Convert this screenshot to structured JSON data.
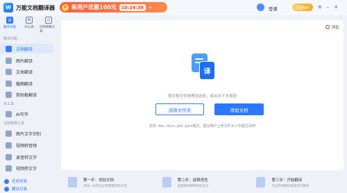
{
  "app": {
    "logo_char": "W",
    "name": "万能文档翻译器"
  },
  "promo": {
    "icon": "¥",
    "text": "新用户优惠100元",
    "countdown": "10:24:38",
    "arrow": "»"
  },
  "user": {
    "login_label": "登录",
    "vip_label": "开通VIP"
  },
  "window": {
    "menu": "≡",
    "minimize": "–",
    "close": "×"
  },
  "top_icons": [
    {
      "glyph": "译",
      "label": "翻译功能",
      "active": true
    },
    {
      "glyph": "AI",
      "label": "AI工具",
      "active": false
    },
    {
      "glyph": "⇄",
      "label": "识别转换工具",
      "active": false
    }
  ],
  "sidebar": {
    "section_translate": "翻译功能",
    "section_ai": "AI工具",
    "section_convert": "识别转换工具",
    "items": [
      {
        "label": "文档翻译",
        "active": true
      },
      {
        "label": "图片翻译"
      },
      {
        "label": "文本翻译"
      },
      {
        "label": "截图翻译"
      },
      {
        "label": "剪贴板翻译"
      },
      {
        "label": "AI写作"
      },
      {
        "label": "图片文字识别"
      },
      {
        "label": "视频转音频"
      },
      {
        "label": "录音转文字"
      },
      {
        "label": "视频转文字"
      }
    ],
    "bottom": [
      {
        "label": "任务列表"
      },
      {
        "label": "翻译记录"
      }
    ]
  },
  "main": {
    "compare_label": "对比",
    "doc_icon_char": "译",
    "drop_hint": "将文档文件拖拽至此处，或点击下方按钮",
    "select_button": "选择文件夹",
    "add_button": "添加文档",
    "support_text": "支持 .doc,.docx,.pdf,.pptx格式，建议用户上传文件大小不超过20M"
  },
  "steps": [
    {
      "title": "第一步：添加文档",
      "desc": "添加一份或多份需要翻译的文档"
    },
    {
      "title": "第二步：选择语言",
      "desc": "选择源语种和目标语言"
    },
    {
      "title": "第三步：开始翻译",
      "desc": "点击开始翻译按钮进行翻译"
    }
  ]
}
